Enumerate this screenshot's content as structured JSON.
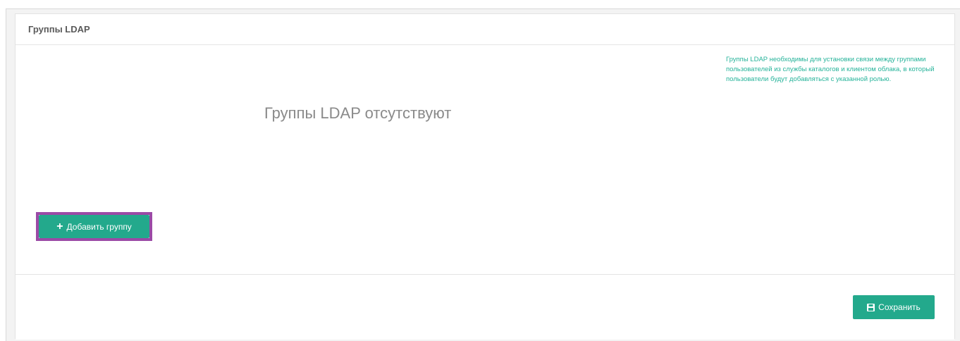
{
  "panel": {
    "title": "Группы LDAP",
    "empty_message": "Группы LDAP отсутствуют",
    "hint": "Группы LDAP необходимы для установки связи между группами пользователей из службы каталогов и клиентом облака, в который пользователи будут добавляться с указанной ролью.",
    "add_button": {
      "icon": "plus-icon",
      "label": "Добавить группу"
    }
  },
  "footer": {
    "save_button": {
      "icon": "floppy-disk-icon",
      "label": "Сохранить"
    }
  },
  "colors": {
    "accent": "#23a98c",
    "hint": "#26b39a",
    "highlight": "#9b4aa6"
  }
}
